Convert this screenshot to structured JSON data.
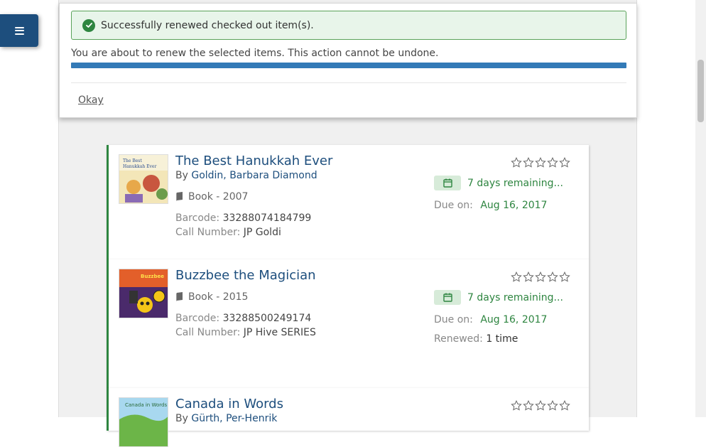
{
  "modal": {
    "alert_message": "Successfully renewed checked out item(s).",
    "warning_text": "You are about to renew the selected items. This action cannot be undone.",
    "progress_fraction": 1.0,
    "okay_label": "Okay"
  },
  "icons": {
    "menu": "hamburger-menu-icon",
    "alert": "check-circle-icon",
    "format": "book-icon",
    "due": "calendar-icon",
    "rating": "star-outline-icon"
  },
  "colors": {
    "accent": "#1d4e7d",
    "success": "#2e8540",
    "progress": "#337ab7"
  },
  "items": [
    {
      "title": "The Best Hanukkah Ever",
      "by_prefix": "By",
      "author": "Goldin, Barbara Diamond",
      "format": "Book - 2007",
      "barcode_label": "Barcode:",
      "barcode": "33288074184799",
      "call_label": "Call Number:",
      "call_number": "JP Goldi",
      "remaining": "7 days remaining...",
      "due_label": "Due on:",
      "due_date": "Aug 16, 2017",
      "rating": 0
    },
    {
      "title": "Buzzbee the Magician",
      "format": "Book - 2015",
      "barcode_label": "Barcode:",
      "barcode": "33288500249174",
      "call_label": "Call Number:",
      "call_number": "JP Hive SERIES",
      "remaining": "7 days remaining...",
      "due_label": "Due on:",
      "due_date": "Aug 16, 2017",
      "renewed_label": "Renewed:",
      "renewed_value": "1 time",
      "rating": 0
    },
    {
      "title": "Canada in Words",
      "by_prefix": "By",
      "author": "Gürth, Per-Henrik",
      "rating": 0
    }
  ]
}
